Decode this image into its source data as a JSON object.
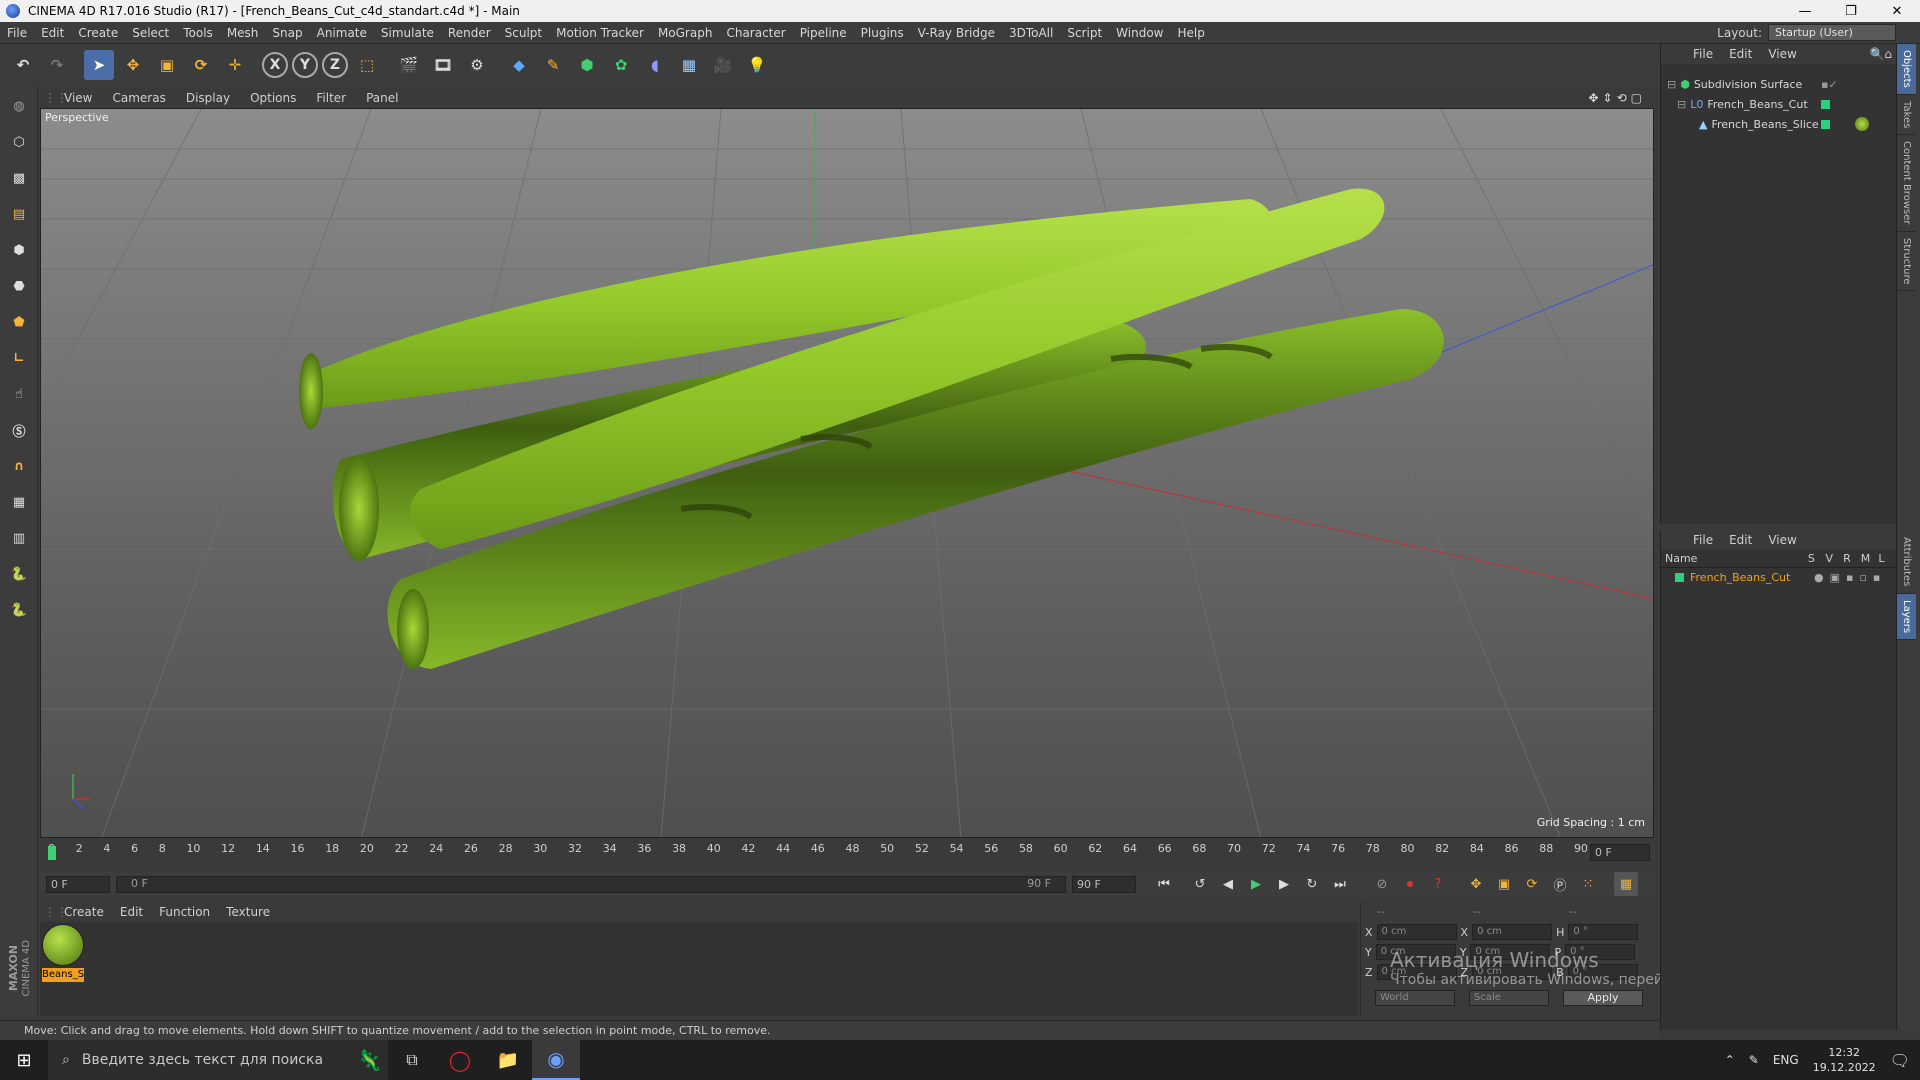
{
  "window": {
    "title": "CINEMA 4D R17.016 Studio (R17) - [French_Beans_Cut_c4d_standart.c4d *] - Main",
    "minimize": "—",
    "maximize": "❐",
    "close": "✕"
  },
  "menubar": {
    "items": [
      "File",
      "Edit",
      "Create",
      "Select",
      "Tools",
      "Mesh",
      "Snap",
      "Animate",
      "Simulate",
      "Render",
      "Sculpt",
      "Motion Tracker",
      "MoGraph",
      "Character",
      "Pipeline",
      "Plugins",
      "V-Ray Bridge",
      "3DToAll",
      "Script",
      "Window",
      "Help"
    ],
    "layout_label": "Layout:",
    "layout_value": "Startup (User)"
  },
  "toolbar": {
    "axis_x": "X",
    "axis_y": "Y",
    "axis_z": "Z"
  },
  "viewport": {
    "menu": [
      "View",
      "Cameras",
      "Display",
      "Options",
      "Filter",
      "Panel"
    ],
    "label": "Perspective",
    "grid_spacing": "Grid Spacing : 1 cm"
  },
  "timeline": {
    "ticks": [
      "0",
      "2",
      "4",
      "6",
      "8",
      "10",
      "12",
      "14",
      "16",
      "18",
      "20",
      "22",
      "24",
      "26",
      "28",
      "30",
      "32",
      "34",
      "36",
      "38",
      "40",
      "42",
      "44",
      "46",
      "48",
      "50",
      "52",
      "54",
      "56",
      "58",
      "60",
      "62",
      "64",
      "66",
      "68",
      "70",
      "72",
      "74",
      "76",
      "78",
      "80",
      "82",
      "84",
      "86",
      "88",
      "90"
    ],
    "current_frame_right": "0 F",
    "start_frame": "0 F",
    "range_start": "0 F",
    "range_end": "90 F",
    "end_frame": "90 F"
  },
  "material_manager": {
    "menu": [
      "Create",
      "Edit",
      "Function",
      "Texture"
    ],
    "material_name": "Beans_S"
  },
  "coordinates": {
    "x_pos": "0 cm",
    "x_size": "0 cm",
    "h_rot": "0 °",
    "y_pos": "0 cm",
    "y_size": "0 cm",
    "p_rot": "0 °",
    "z_pos": "0 cm",
    "z_size": "0 cm",
    "b_rot": "0 °",
    "label_x": "X",
    "label_y": "Y",
    "label_z": "Z",
    "label_h": "H",
    "label_p": "P",
    "label_b": "B",
    "mode_1": "World",
    "mode_2": "Scale",
    "apply": "Apply",
    "dash": "--"
  },
  "object_manager": {
    "menu": [
      "File",
      "Edit",
      "View"
    ],
    "objects": [
      {
        "name": "Subdivision Surface"
      },
      {
        "name": "French_Beans_Cut"
      },
      {
        "name": "French_Beans_Slice"
      }
    ]
  },
  "layer_manager": {
    "menu": [
      "File",
      "Edit",
      "View"
    ],
    "columns": [
      "Name",
      "S",
      "V",
      "R",
      "M",
      "L"
    ],
    "layers": [
      {
        "name": "French_Beans_Cut"
      }
    ]
  },
  "right_tabs": [
    "Objects",
    "Takes",
    "Content Browser",
    "Structure",
    "Attributes",
    "Layers"
  ],
  "status": {
    "text": "Move: Click and drag to move elements. Hold down SHIFT to quantize movement / add to the selection in point mode, CTRL to remove."
  },
  "taskbar": {
    "search_placeholder": "Введите здесь текст для поиска",
    "language": "ENG",
    "time": "12:32",
    "date": "19.12.2022"
  },
  "watermark": {
    "line1": "Активация Windows",
    "line2": "Чтобы активировать Windows, перейдите в раздел \"Параметры\"."
  },
  "brand": {
    "maxon": "MAXON",
    "c4d": "CINEMA 4D"
  },
  "colors": {
    "accent_blue": "#4a8ad8",
    "bean_green": "#9fcf2f",
    "object_green": "#2bd17e",
    "layer_orange": "#f0a020"
  }
}
